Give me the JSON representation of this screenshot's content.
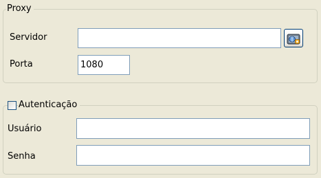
{
  "proxy": {
    "legend": "Proxy",
    "server_label": "Servidor",
    "server_value": "",
    "browse_icon": "network-folder-icon",
    "port_label": "Porta",
    "port_value": "1080"
  },
  "auth": {
    "legend": "Autenticação",
    "checked": false,
    "user_label": "Usuário",
    "user_value": "",
    "password_label": "Senha",
    "password_value": ""
  },
  "colors": {
    "dialog_background": "#ECE9D8",
    "groupbox_border": "#D0D0BF",
    "input_border": "#7F9DB9",
    "checkbox_border": "#1C5180",
    "button_border": "#003C74"
  }
}
